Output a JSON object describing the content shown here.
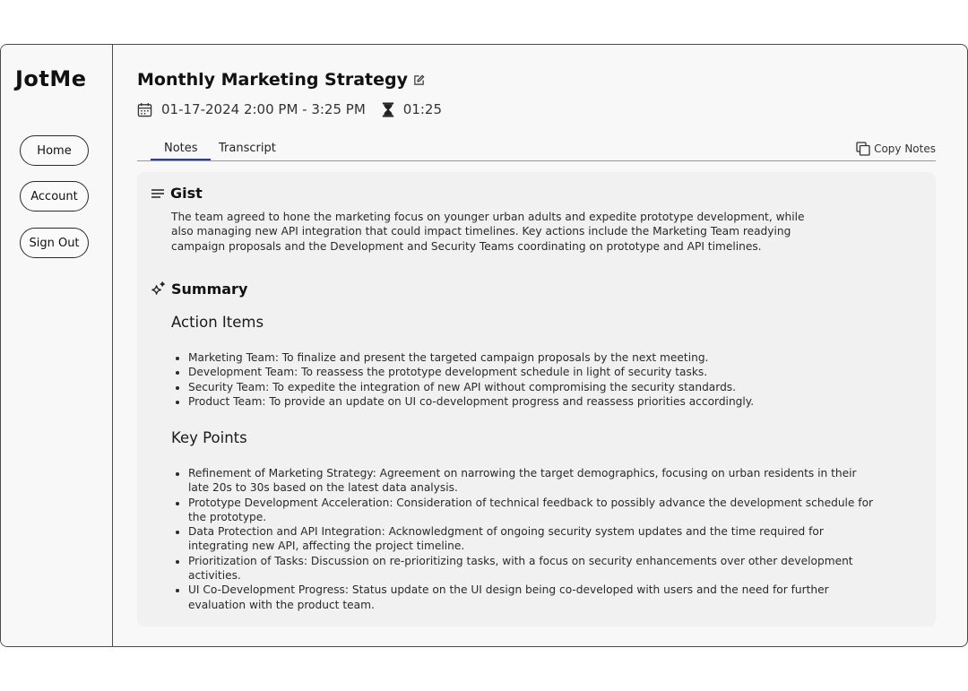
{
  "sidebar": {
    "logo": "JotMe",
    "items": [
      {
        "label": "Home"
      },
      {
        "label": "Account"
      },
      {
        "label": "Sign Out"
      }
    ]
  },
  "header": {
    "title": "Monthly Marketing Strategy",
    "datetime": "01-17-2024 2:00 PM - 3:25 PM",
    "duration": "01:25"
  },
  "tabs": [
    {
      "label": "Notes",
      "active": true
    },
    {
      "label": "Transcript",
      "active": false
    }
  ],
  "copy_notes_label": "Copy Notes",
  "gist": {
    "heading": "Gist",
    "text": "The team agreed to hone the marketing focus on younger urban adults and expedite prototype development, while also managing new API integration that could impact timelines. Key actions include the Marketing Team readying campaign proposals and the Development and Security Teams coordinating on prototype and API timelines."
  },
  "summary": {
    "heading": "Summary",
    "action_items": {
      "heading": "Action Items",
      "items": [
        "Marketing Team: To finalize and present the targeted campaign proposals by the next meeting.",
        "Development Team: To reassess the prototype development schedule in light of security tasks.",
        "Security Team: To expedite the integration of new API without compromising the security standards.",
        "Product Team: To provide an update on UI co-development progress and reassess priorities accordingly."
      ]
    },
    "key_points": {
      "heading": "Key Points",
      "items": [
        "Refinement of Marketing Strategy: Agreement on narrowing the target demographics, focusing on urban residents in their late 20s to 30s based on the latest data analysis.",
        "Prototype Development Acceleration: Consideration of technical feedback to possibly advance the development schedule for the prototype.",
        "Data Protection and API Integration: Acknowledgment of ongoing security system updates and the time required for integrating new API, affecting the project timeline.",
        "Prioritization of Tasks: Discussion on re-prioritizing tasks, with a focus on security enhancements over other development activities.",
        "UI Co-Development Progress: Status update on the UI design being co-developed with users and the need for further evaluation with the product team."
      ]
    }
  },
  "colors": {
    "active_tab_underline": "#2b3da8",
    "content_background": "#f1f1f1",
    "border": "#4a4a4a"
  }
}
